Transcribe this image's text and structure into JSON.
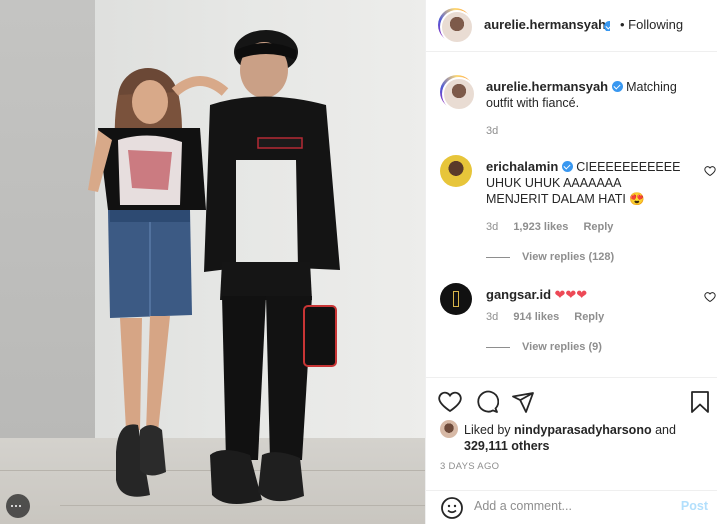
{
  "post": {
    "username": "aurelie.hermansyah",
    "following_label": "• Following",
    "caption_username": "aurelie.hermansyah",
    "caption_text": "Matching outfit with fiancé.",
    "caption_age": "3d",
    "comments": [
      {
        "username": "erichalamin",
        "text": "CIEEEEEEEEEEE UHUK UHUK AAAAAAA MENJERIT DALAM HATI 😍",
        "age": "3d",
        "likes": "1,923 likes",
        "reply": "Reply",
        "view_replies": "View replies (128)"
      },
      {
        "username": "gangsar.id",
        "text": "❤❤❤",
        "age": "3d",
        "likes": "914 likes",
        "reply": "Reply",
        "view_replies": "View replies (9)"
      }
    ],
    "liked_by_prefix": "Liked by",
    "liked_by_user": "nindyparasadyharsono",
    "liked_by_and": "and",
    "liked_by_others": "329,111 others",
    "time_ago": "3 DAYS AGO",
    "comment_placeholder": "Add a comment...",
    "post_button": "Post"
  },
  "colors": {
    "accent_blue": "#3897f0",
    "post_disabled": "#b2dffc",
    "heart_red": "#ed4956",
    "muted_text": "#8e8e8e"
  },
  "icons": [
    "heart-icon",
    "comment-icon",
    "share-icon",
    "bookmark-icon",
    "emoji-icon",
    "more-icon",
    "small-heart-icon"
  ]
}
